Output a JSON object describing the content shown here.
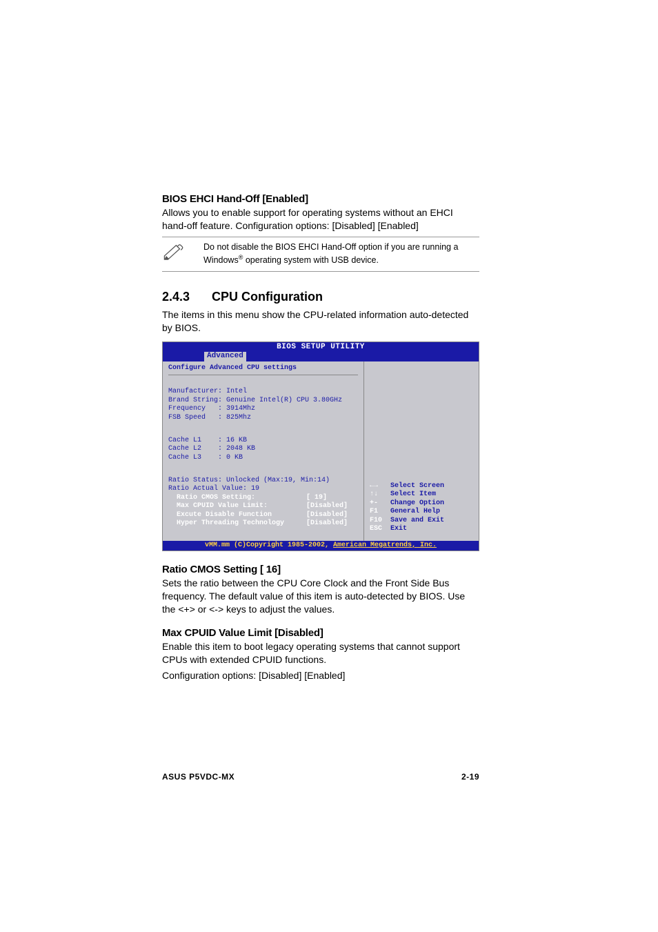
{
  "sections": {
    "ehci": {
      "title": "BIOS EHCI Hand-Off [Enabled]",
      "body": "Allows you to enable support for operating systems without an EHCI hand-off feature. Configuration options: [Disabled] [Enabled]",
      "note_pre": "Do not disable the BIOS EHCI Hand-Off option if you are running a Windows",
      "note_reg": "®",
      "note_post": " operating system with USB device."
    },
    "cpu": {
      "number": "2.4.3",
      "title": "CPU Configuration",
      "body": "The items in this menu show the CPU-related information auto-detected by BIOS."
    },
    "ratio": {
      "title": "Ratio CMOS Setting [ 16]",
      "body": "Sets the ratio between the CPU Core Clock and the Front Side Bus frequency. The default value of this item is auto-detected by BIOS. Use the <+> or <-> keys to adjust the values."
    },
    "cpuid": {
      "title": "Max CPUID Value Limit [Disabled]",
      "body1": "Enable this item to boot legacy operating systems that cannot support CPUs with extended CPUID functions.",
      "body2": "Configuration options: [Disabled] [Enabled]"
    }
  },
  "bios": {
    "title": "BIOS SETUP UTILITY",
    "tab": "Advanced",
    "header": "Configure Advanced CPU settings",
    "info": {
      "manufacturer": "Manufacturer: Intel",
      "brand": "Brand String: Genuine Intel(R) CPU 3.80GHz",
      "freq": "Frequency   : 3914Mhz",
      "fsb": "FSB Speed   : 825Mhz"
    },
    "cache": {
      "l1": "Cache L1    : 16 KB",
      "l2": "Cache L2    : 2048 KB",
      "l3": "Cache L3    : 0 KB"
    },
    "ratio_status": "Ratio Status: Unlocked (Max:19, Min:14)",
    "ratio_actual": "Ratio Actual Value: 19",
    "items": {
      "ratio_cmos_label": "  Ratio CMOS Setting:",
      "ratio_cmos_value": "[ 19]",
      "max_cpuid_label": "  Max CPUID Value Limit:",
      "max_cpuid_value": "[Disabled]",
      "execute_label": "  Excute Disable Function",
      "execute_value": "[Disabled]",
      "hyper_label": "  Hyper Threading Technology",
      "hyper_value": "[Disabled]"
    },
    "legend": {
      "l1a": "←→",
      "l1b": "Select Screen",
      "l2a": "↑↓",
      "l2b": "Select Item",
      "l3a": "+-",
      "l3b": "Change Option",
      "l4a": "F1",
      "l4b": "General Help",
      "l5a": "F10",
      "l5b": "Save and Exit",
      "l6a": "ESC",
      "l6b": "Exit"
    },
    "footer_pre": "vMM.mm (C)Copyright 1985-2002, ",
    "footer_ul": "American Megatrends, Inc."
  },
  "footer": {
    "left": "ASUS P5VDC-MX",
    "right": "2-19"
  }
}
